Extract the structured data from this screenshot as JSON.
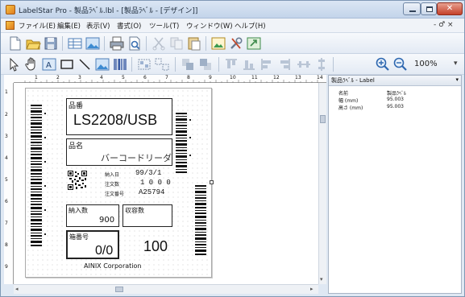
{
  "window": {
    "title": "LabelStar Pro - 製品ﾗﾍﾞﾙ.lbl - [製品ﾗﾍﾞﾙ - [デザイン]]"
  },
  "menu": {
    "items": [
      "ファイル(E)",
      "編集(E)",
      "表示(V)",
      "書式(O)",
      "ツール(T)",
      "ウィンドウ(W)",
      "ヘルプ(H)"
    ],
    "mdi_controls": "- ♂ ×"
  },
  "toolbar": {
    "zoom": "100%"
  },
  "ruler": {
    "h_numbers": [
      "1",
      "2",
      "3",
      "4",
      "5",
      "6",
      "7",
      "8",
      "9",
      "10",
      "11",
      "12",
      "13",
      "14"
    ],
    "v_numbers": [
      "1",
      "2",
      "3",
      "4",
      "5",
      "6",
      "7",
      "8",
      "9"
    ]
  },
  "label": {
    "item_no_caption": "品番",
    "item_no_value": "LS2208/USB",
    "item_name_caption": "品名",
    "item_name_value": "バーコードリーダ",
    "date_caption": "納入日",
    "date_value": "99/3/1",
    "qty_caption": "注文数",
    "qty_value": "1 0 0 0",
    "order_caption": "注文番号",
    "order_value": "A25794",
    "delivery_caption": "納入数",
    "delivery_value": "900",
    "received_caption": "収容数",
    "box_no_caption": "箱番号",
    "box_no_value": "0/0",
    "box_total_value": "100",
    "company": "AINIX Corporation"
  },
  "properties": {
    "object_selector": "製品ﾗﾍﾞﾙ - Label",
    "rows": [
      {
        "key": "名前",
        "value": "製品ﾗﾍﾞﾙ"
      },
      {
        "key": "幅 (mm)",
        "value": "95.003"
      },
      {
        "key": "高さ (mm)",
        "value": "95.003"
      }
    ]
  }
}
